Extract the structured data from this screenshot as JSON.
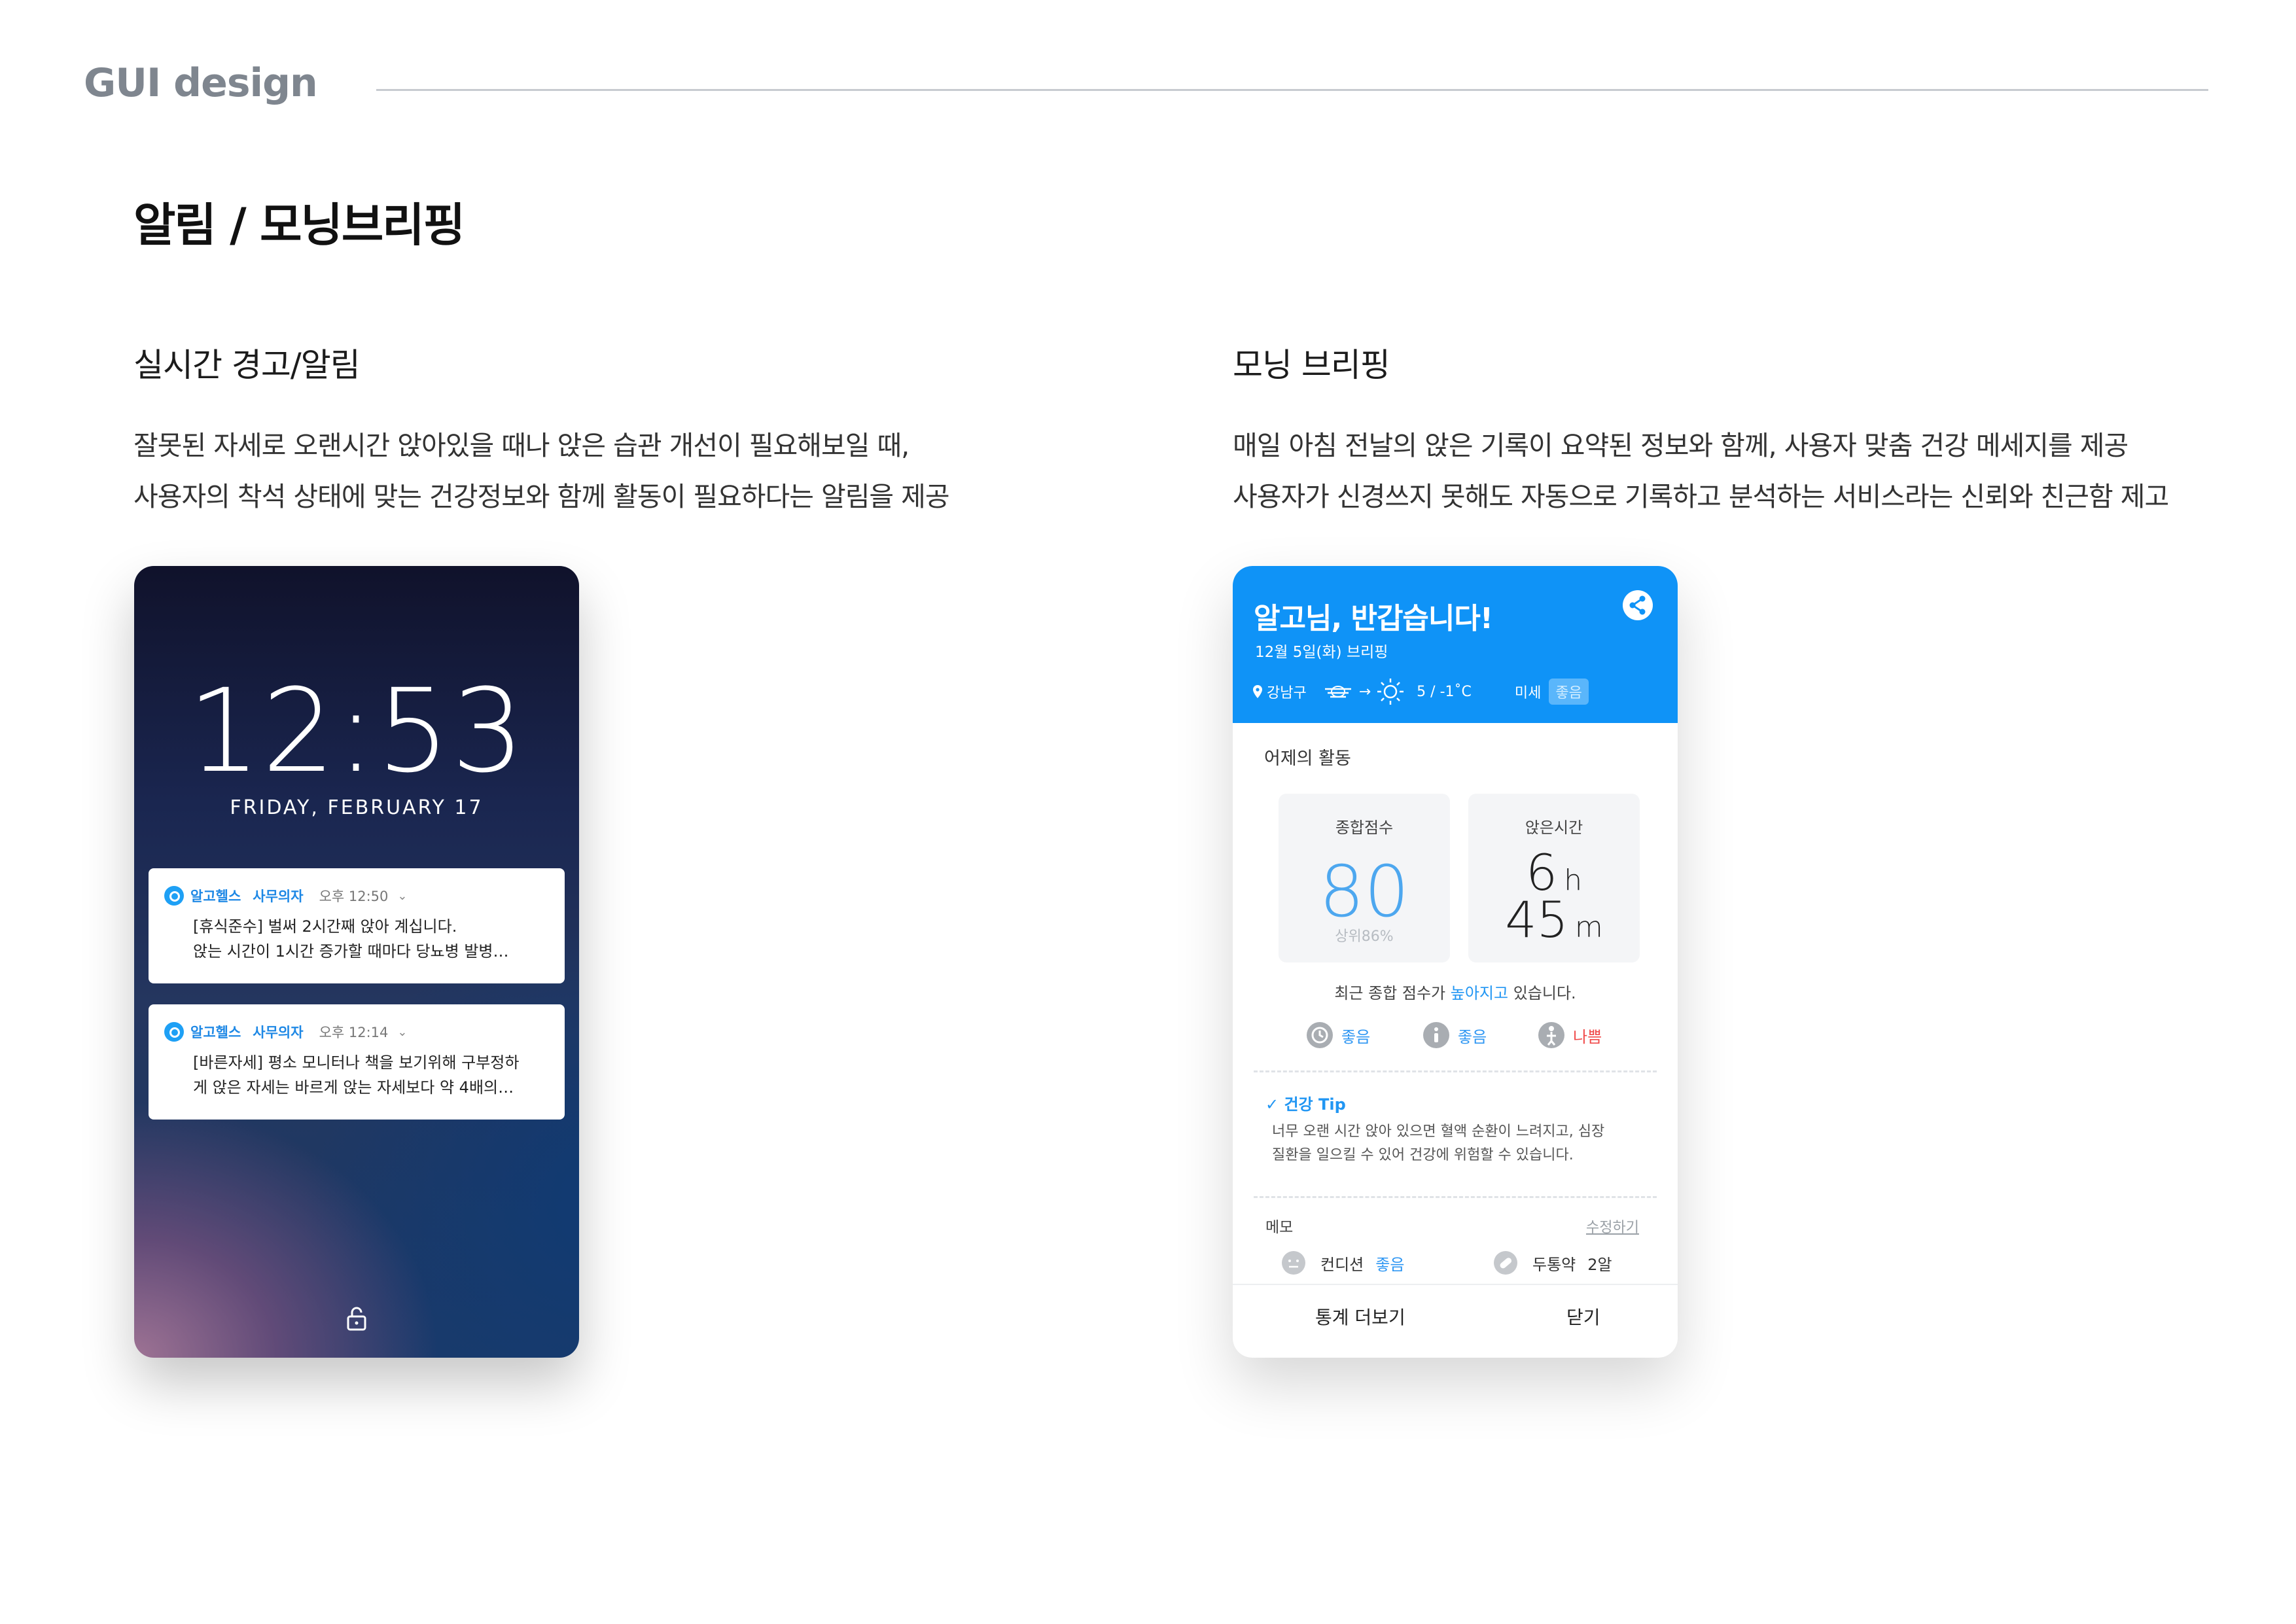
{
  "header": {
    "brand": "GUI design",
    "page_title": "알림 / 모닝브리핑"
  },
  "left_section": {
    "title": "실시간 경고/알림",
    "desc_line1": "잘못된 자세로 오랜시간 앉아있을 때나 앉은 습관 개선이 필요해보일 때,",
    "desc_line2": "사용자의 착석 상태에 맞는 건강정보와 함께 활동이 필요하다는 알림을 제공"
  },
  "right_section": {
    "title": "모닝 브리핑",
    "desc_line1": "매일 아침 전날의 앉은 기록이 요약된 정보와 함께, 사용자 맞춤 건강 메세지를 제공",
    "desc_line2": "사용자가 신경쓰지 못해도 자동으로 기록하고 분석하는 서비스라는 신뢰와 친근함 제고"
  },
  "lockscreen": {
    "time": "12:53",
    "date": "FRIDAY, FEBRUARY 17",
    "notifications": [
      {
        "app": "알고헬스",
        "sub": "사무의자",
        "time": "오후 12:50",
        "line1": "[휴식준수] 벌써 2시간째 앉아 계십니다.",
        "line2": "앉는 시간이 1시간 증가할 때마다 당뇨병 발병…"
      },
      {
        "app": "알고헬스",
        "sub": "사무의자",
        "time": "오후 12:14",
        "line1": "[바른자세] 평소 모니터나 책을 보기위해 구부정하",
        "line2": "게 앉은 자세는 바르게 앉는 자세보다 약 4배의…"
      }
    ]
  },
  "briefing": {
    "greeting": "알고님, 반갑습니다!",
    "date_label": "12월 5일(화) 브리핑",
    "location": "강남구",
    "arrow": "→",
    "temperature": "5 / -1˚C",
    "dust_label": "미세",
    "dust_status": "좋음",
    "activity_label": "어제의 활동",
    "score_title": "종합점수",
    "score_value": "80",
    "score_rank": "상위86%",
    "sit_title": "앉은시간",
    "sit_hours": "6",
    "sit_hours_unit": "h",
    "sit_minutes": "45",
    "sit_minutes_unit": "m",
    "trend_prefix": "최근 종합 점수가 ",
    "trend_highlight": "높아지고",
    "trend_suffix": " 있습니다.",
    "status_items": [
      {
        "label": "좋음",
        "state": "good",
        "icon": "clock-icon"
      },
      {
        "label": "좋음",
        "state": "good",
        "icon": "info-icon"
      },
      {
        "label": "나쁨",
        "state": "bad",
        "icon": "posture-icon"
      }
    ],
    "tip_title": "건강 Tip",
    "tip_line1": "너무 오랜 시간 앉아 있으면 혈액 순환이 느려지고, 심장",
    "tip_line2": "질환을 일으킬 수 있어 건강에 위험할 수 있습니다.",
    "memo_label": "메모",
    "memo_edit": "수정하기",
    "condition_label": "컨디션",
    "condition_value": "좋음",
    "pill_label": "두통약",
    "pill_value": "2알",
    "btn_stats": "통계 더보기",
    "btn_close": "닫기"
  },
  "colors": {
    "accent_blue": "#0f93f7",
    "good": "#2f97f3",
    "bad": "#f04a4a",
    "brand_gray": "#7f868f"
  }
}
